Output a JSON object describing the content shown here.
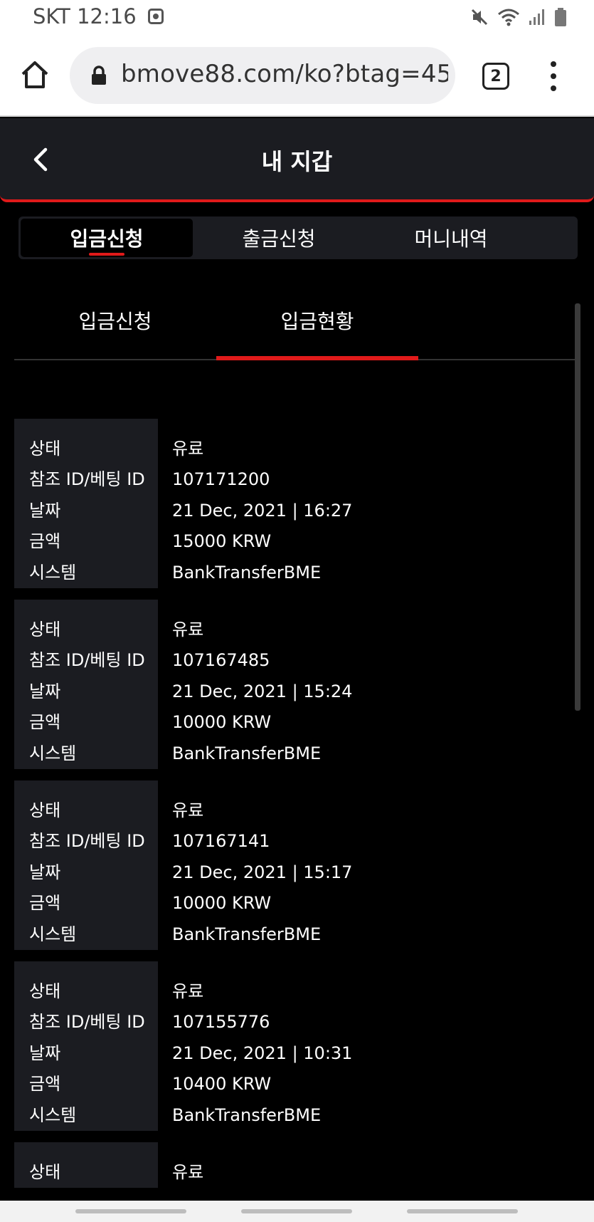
{
  "status_bar": {
    "carrier_time": "SKT 12:16"
  },
  "browser": {
    "url": "bmove88.com/ko?btag=458",
    "tab_count": "2"
  },
  "header": {
    "title": "내 지갑"
  },
  "main_tabs": [
    {
      "label": "입금신청"
    },
    {
      "label": "출금신청"
    },
    {
      "label": "머니내역"
    }
  ],
  "sub_tabs": [
    {
      "label": "입금신청"
    },
    {
      "label": "입금현황"
    }
  ],
  "field_labels": {
    "status": "상태",
    "ref_id": "참조 ID/베팅 ID",
    "date": "날짜",
    "amount": "금액",
    "system": "시스템"
  },
  "records": [
    {
      "status": "유료",
      "ref_id": "107171200",
      "date": "21 Dec, 2021 | 16:27",
      "amount": "15000 KRW",
      "system": "BankTransferBME"
    },
    {
      "status": "유료",
      "ref_id": "107167485",
      "date": "21 Dec, 2021 | 15:24",
      "amount": "10000 KRW",
      "system": "BankTransferBME"
    },
    {
      "status": "유료",
      "ref_id": "107167141",
      "date": "21 Dec, 2021 | 15:17",
      "amount": "10000 KRW",
      "system": "BankTransferBME"
    },
    {
      "status": "유료",
      "ref_id": "107155776",
      "date": "21 Dec, 2021 | 10:31",
      "amount": "10400 KRW",
      "system": "BankTransferBME"
    },
    {
      "status": "유료"
    }
  ],
  "colors": {
    "accent": "#e01a1a",
    "panel": "#1b1c21",
    "background": "#000000"
  }
}
